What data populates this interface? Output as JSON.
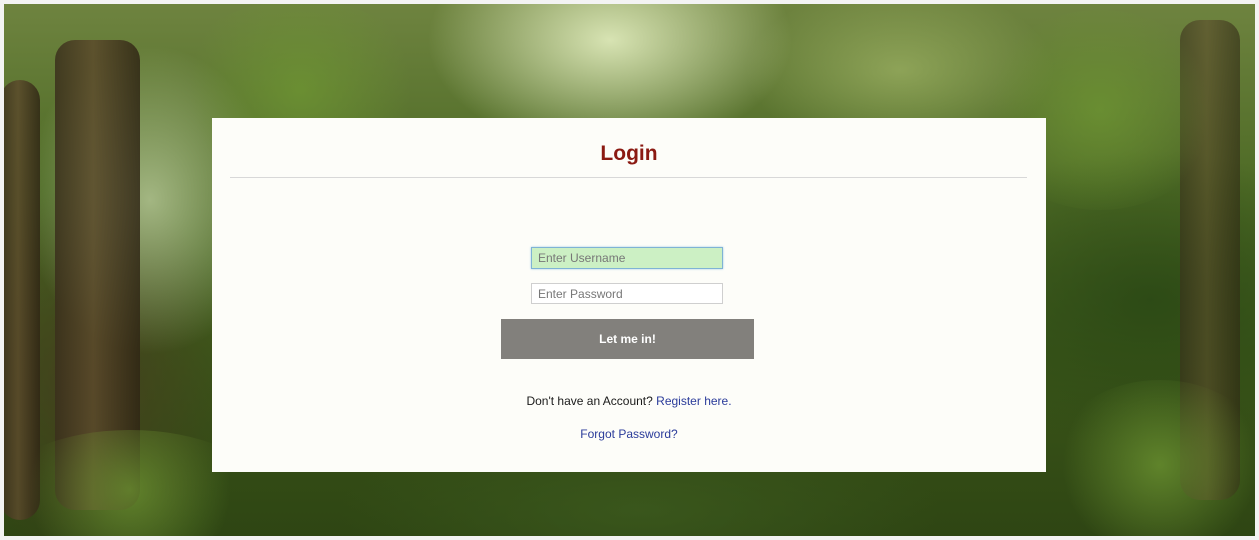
{
  "login": {
    "title": "Login",
    "username_placeholder": "Enter Username",
    "password_placeholder": "Enter Password",
    "submit_label": "Let me in!",
    "register_prompt": "Don't have an Account?",
    "register_link": "Register here.",
    "forgot_link": "Forgot Password?"
  },
  "colors": {
    "title": "#8b1a12",
    "button_bg": "#82807c",
    "username_bg": "#ccf0c4",
    "link": "#2a3b9a",
    "card_bg": "#fdfdf9"
  }
}
